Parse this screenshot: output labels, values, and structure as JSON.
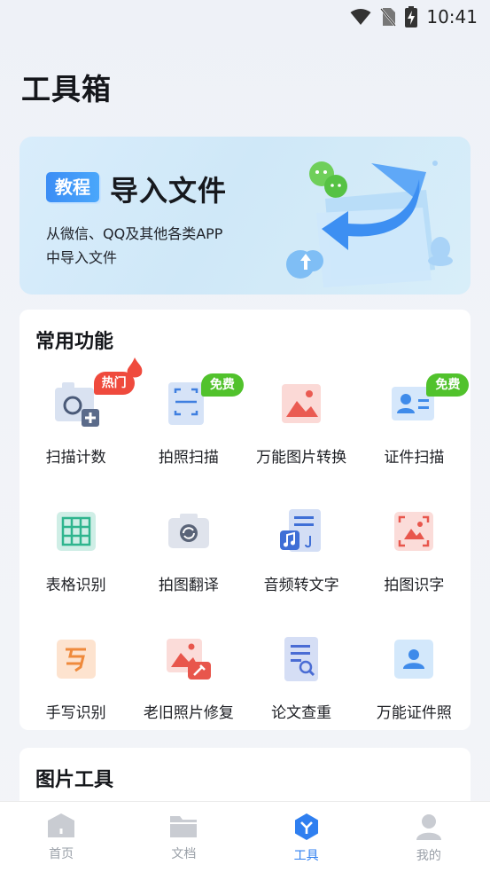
{
  "status": {
    "time": "10:41"
  },
  "page": {
    "title": "工具箱"
  },
  "banner": {
    "tag": "教程",
    "title": "导入文件",
    "desc_line1": "从微信、QQ及其他各类APP",
    "desc_line2": "中导入文件"
  },
  "common": {
    "title": "常用功能",
    "items": [
      {
        "label": "扫描计数",
        "icon": "scan-count-icon",
        "badge": "热门"
      },
      {
        "label": "拍照扫描",
        "icon": "photo-scan-icon",
        "badge": "免费"
      },
      {
        "label": "万能图片转换",
        "icon": "image-convert-icon"
      },
      {
        "label": "证件扫描",
        "icon": "id-scan-icon",
        "badge": "免费"
      },
      {
        "label": "表格识别",
        "icon": "table-icon"
      },
      {
        "label": "拍图翻译",
        "icon": "camera-translate-icon"
      },
      {
        "label": "音频转文字",
        "icon": "audio-text-icon"
      },
      {
        "label": "拍图识字",
        "icon": "photo-text-icon"
      },
      {
        "label": "手写识别",
        "icon": "handwriting-icon"
      },
      {
        "label": "老旧照片修复",
        "icon": "photo-repair-icon"
      },
      {
        "label": "论文查重",
        "icon": "paper-check-icon"
      },
      {
        "label": "万能证件照",
        "icon": "id-photo-icon"
      }
    ]
  },
  "image_tools": {
    "title": "图片工具"
  },
  "nav": {
    "items": [
      {
        "label": "首页",
        "icon": "home-icon"
      },
      {
        "label": "文档",
        "icon": "folder-icon"
      },
      {
        "label": "工具",
        "icon": "tools-icon"
      },
      {
        "label": "我的",
        "icon": "profile-icon"
      }
    ],
    "active_color": "#2f7ff0",
    "inactive_color": "#9aa0a8"
  }
}
